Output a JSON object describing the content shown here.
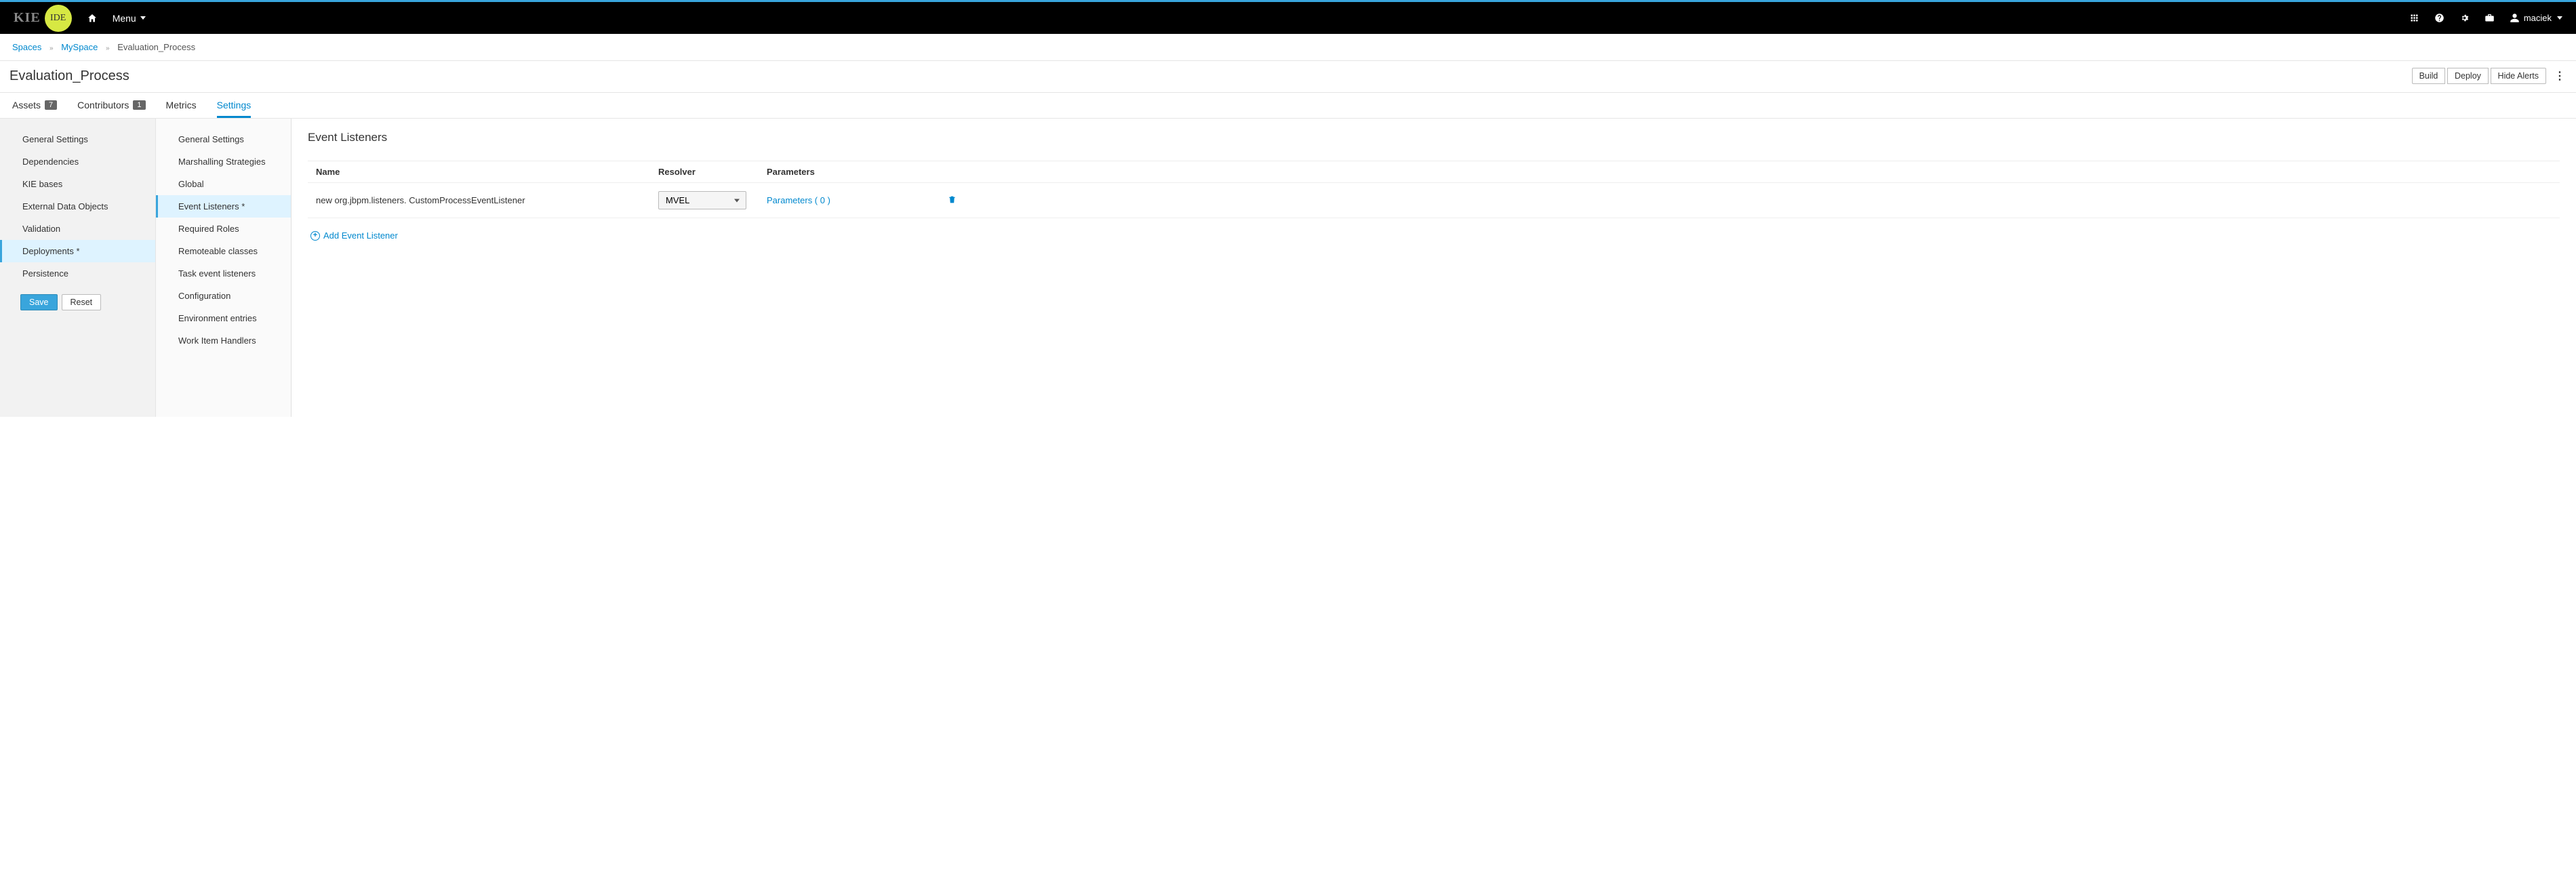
{
  "header": {
    "logo_left": "KIE",
    "logo_right": "IDE",
    "menu_label": "Menu",
    "user": "maciek"
  },
  "breadcrumb": {
    "items": [
      "Spaces",
      "MySpace",
      "Evaluation_Process"
    ]
  },
  "titlebar": {
    "title": "Evaluation_Process",
    "actions": {
      "build": "Build",
      "deploy": "Deploy",
      "hide_alerts": "Hide Alerts"
    }
  },
  "tabs": [
    {
      "label": "Assets",
      "badge": "7"
    },
    {
      "label": "Contributors",
      "badge": "1"
    },
    {
      "label": "Metrics"
    },
    {
      "label": "Settings",
      "active": true
    }
  ],
  "sidebar1": {
    "items": [
      {
        "label": "General Settings"
      },
      {
        "label": "Dependencies"
      },
      {
        "label": "KIE bases"
      },
      {
        "label": "External Data Objects"
      },
      {
        "label": "Validation"
      },
      {
        "label": "Deployments *",
        "active": true
      },
      {
        "label": "Persistence"
      }
    ],
    "save": "Save",
    "reset": "Reset"
  },
  "sidebar2": {
    "items": [
      {
        "label": "General Settings"
      },
      {
        "label": "Marshalling Strategies"
      },
      {
        "label": "Global"
      },
      {
        "label": "Event Listeners *",
        "active": true
      },
      {
        "label": "Required Roles"
      },
      {
        "label": "Remoteable classes"
      },
      {
        "label": "Task event listeners"
      },
      {
        "label": "Configuration"
      },
      {
        "label": "Environment entries"
      },
      {
        "label": "Work Item Handlers"
      }
    ]
  },
  "main": {
    "heading": "Event Listeners",
    "columns": {
      "name": "Name",
      "resolver": "Resolver",
      "parameters": "Parameters"
    },
    "rows": [
      {
        "name": "new org.jbpm.listeners. CustomProcessEventListener",
        "resolver": "MVEL",
        "parameters_label": "Parameters ( 0 )"
      }
    ],
    "add_label": "Add Event Listener"
  }
}
